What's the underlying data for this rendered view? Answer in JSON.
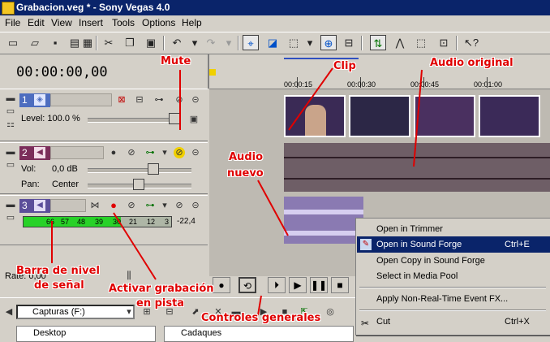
{
  "window": {
    "title": "Grabacion.veg * - Sony Vegas 4.0"
  },
  "menu": [
    "File",
    "Edit",
    "View",
    "Insert",
    "Tools",
    "Options",
    "Help"
  ],
  "timecode": "00:00:00,00",
  "ruler": {
    "labels": [
      "00:00:15",
      "00:00:30",
      "00:00:45",
      "00:01:00"
    ]
  },
  "tracks": {
    "t1": {
      "number": "1",
      "level_label": "Level: 100.0 %"
    },
    "t2": {
      "number": "2",
      "vol_label": "Vol:",
      "vol_value": "0,0 dB",
      "pan_label": "Pan:",
      "pan_value": "Center"
    },
    "t3": {
      "number": "3",
      "meter_ticks": [
        "66",
        "57",
        "48",
        "39",
        "30",
        "21",
        "12",
        "3"
      ],
      "meter_end": "-22,4"
    }
  },
  "rate_label": "Rate: 0,00",
  "context_menu": {
    "items": [
      {
        "label": "Open in Trimmer",
        "shortcut": ""
      },
      {
        "label": "Open in Sound Forge",
        "shortcut": "Ctrl+E",
        "selected": true
      },
      {
        "label": "Open Copy in Sound Forge",
        "shortcut": ""
      },
      {
        "label": "Select in Media Pool",
        "shortcut": ""
      },
      {
        "label": "Apply Non-Real-Time Event FX...",
        "shortcut": ""
      },
      {
        "label": "Cut",
        "shortcut": "Ctrl+X"
      }
    ]
  },
  "explorer": {
    "drive": "Capturas (F:)",
    "list_left": "Desktop",
    "list_right": "Cadaques"
  },
  "annotations": {
    "mute": "Mute",
    "clip": "Clip",
    "audio_original": "Audio original",
    "audio_nuevo_1": "Audio",
    "audio_nuevo_2": "nuevo",
    "barra_1": "Barra de nivel",
    "barra_2": "de señal",
    "activar_1": "Activar grabación",
    "activar_2": "en pista",
    "controles": "Controles generales"
  },
  "colors": {
    "title_bar": "#0a246a",
    "track1": "#4d6dbf",
    "track2": "#7b2d5a",
    "track3": "#5b4e9a",
    "annotation": "#e00000",
    "meter_green": "#28d228"
  }
}
